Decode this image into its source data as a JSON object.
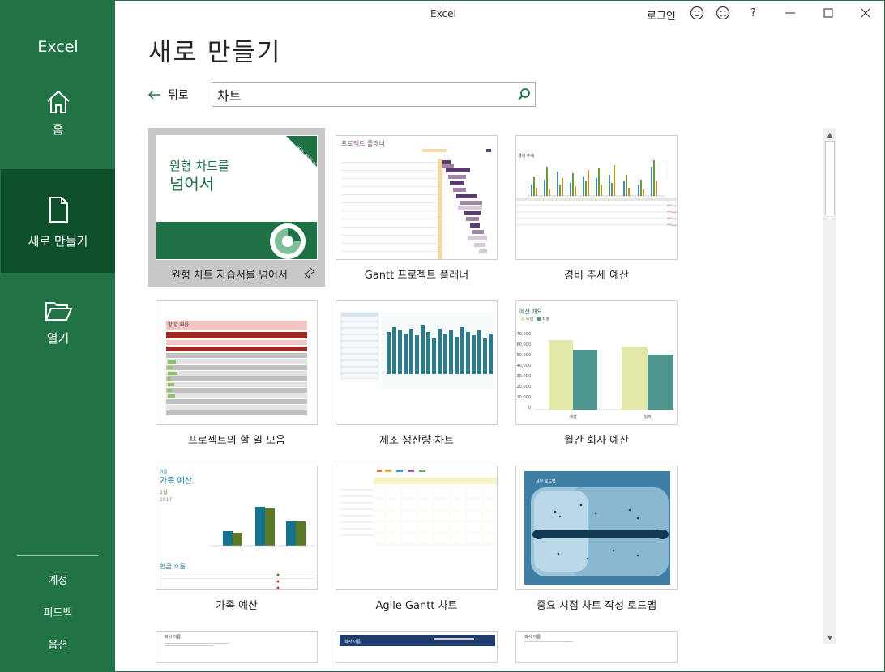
{
  "window": {
    "title": "Excel",
    "login": "로그인"
  },
  "sidebar": {
    "app_name": "Excel",
    "nav": [
      {
        "label": "홈"
      },
      {
        "label": "새로 만들기"
      },
      {
        "label": "열기"
      }
    ],
    "bottom": [
      "계정",
      "피드백",
      "옵션"
    ]
  },
  "main": {
    "title": "새로 만들기",
    "back_label": "뒤로",
    "search_value": "차트"
  },
  "templates": [
    {
      "label": "원형 차트 자습서를 넘어서",
      "thumb_title_1": "원형 차트를",
      "thumb_title_2": "넘어서",
      "ribbon": "새로 만들기",
      "selected": true
    },
    {
      "label": "Gantt 프로젝트 플래너",
      "thumb_title": "프로젝트 플래너"
    },
    {
      "label": "경비 추세 예산",
      "thumb_title": "경비 추세"
    },
    {
      "label": "프로젝트의 할 일 모음",
      "thumb_title": "할 일 모음"
    },
    {
      "label": "제조 생산량 차트"
    },
    {
      "label": "월간 회사 예산",
      "thumb_title": "예산 개요",
      "legend": [
        "수입",
        "지출"
      ],
      "yticks": [
        "70,000",
        "60,000",
        "50,000",
        "40,000",
        "30,000",
        "20,000",
        "10,000",
        "0"
      ],
      "cats": [
        "예상",
        "실제"
      ]
    },
    {
      "label": "가족 예산",
      "thumb_name": "이름",
      "thumb_title": "가족 예산",
      "month": "1월",
      "year": "2017",
      "section": "현금 흐름"
    },
    {
      "label": "Agile Gantt 차트"
    },
    {
      "label": "중요 시점 차트 작성 로드맵",
      "thumb_title": "세부 로드맵"
    },
    {
      "label": "",
      "thumb_title": "회사 이름"
    },
    {
      "label": "",
      "thumb_title": "회사 이름"
    },
    {
      "label": "",
      "thumb_title": "회사 이름"
    }
  ],
  "colors": {
    "brand": "#217346",
    "brand_dark": "#0e4f2b"
  }
}
